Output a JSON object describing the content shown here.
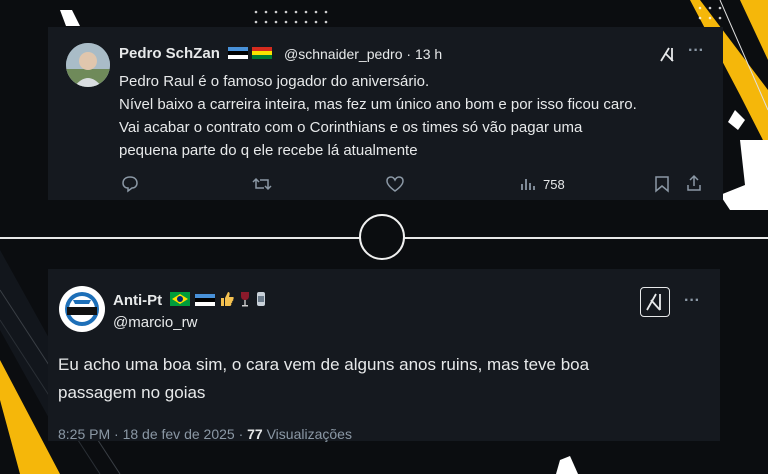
{
  "tweet1": {
    "author_name": "Pedro SchZan",
    "handle_time": "@schnaider_pedro · 13 h",
    "lines": [
      "Pedro Raul é o famoso jogador do aniversário.",
      "Nível baixo a carreira inteira, mas fez um único ano bom e por isso ficou caro.",
      "Vai acabar o contrato com o Corinthians e os times só vão pagar uma",
      "pequena parte do q ele recebe lá atualmente"
    ],
    "views": "758",
    "more": "···"
  },
  "tweet2": {
    "author_name": "Anti-Pt",
    "handle": "@marcio_rw",
    "lines": [
      "Eu acho uma boa sim, o cara vem de alguns anos ruins, mas teve boa",
      "passagem no goias"
    ],
    "timestamp": "8:25 PM · 18 de fev de 2025 · ",
    "views_count": "77",
    "views_label": " Visualizações",
    "more": "···",
    "avatar_text": "GRÊMIO"
  },
  "colors": {
    "accent_yellow": "#f5b70a",
    "card_bg": "#15191f",
    "muted": "#8b98a5"
  }
}
